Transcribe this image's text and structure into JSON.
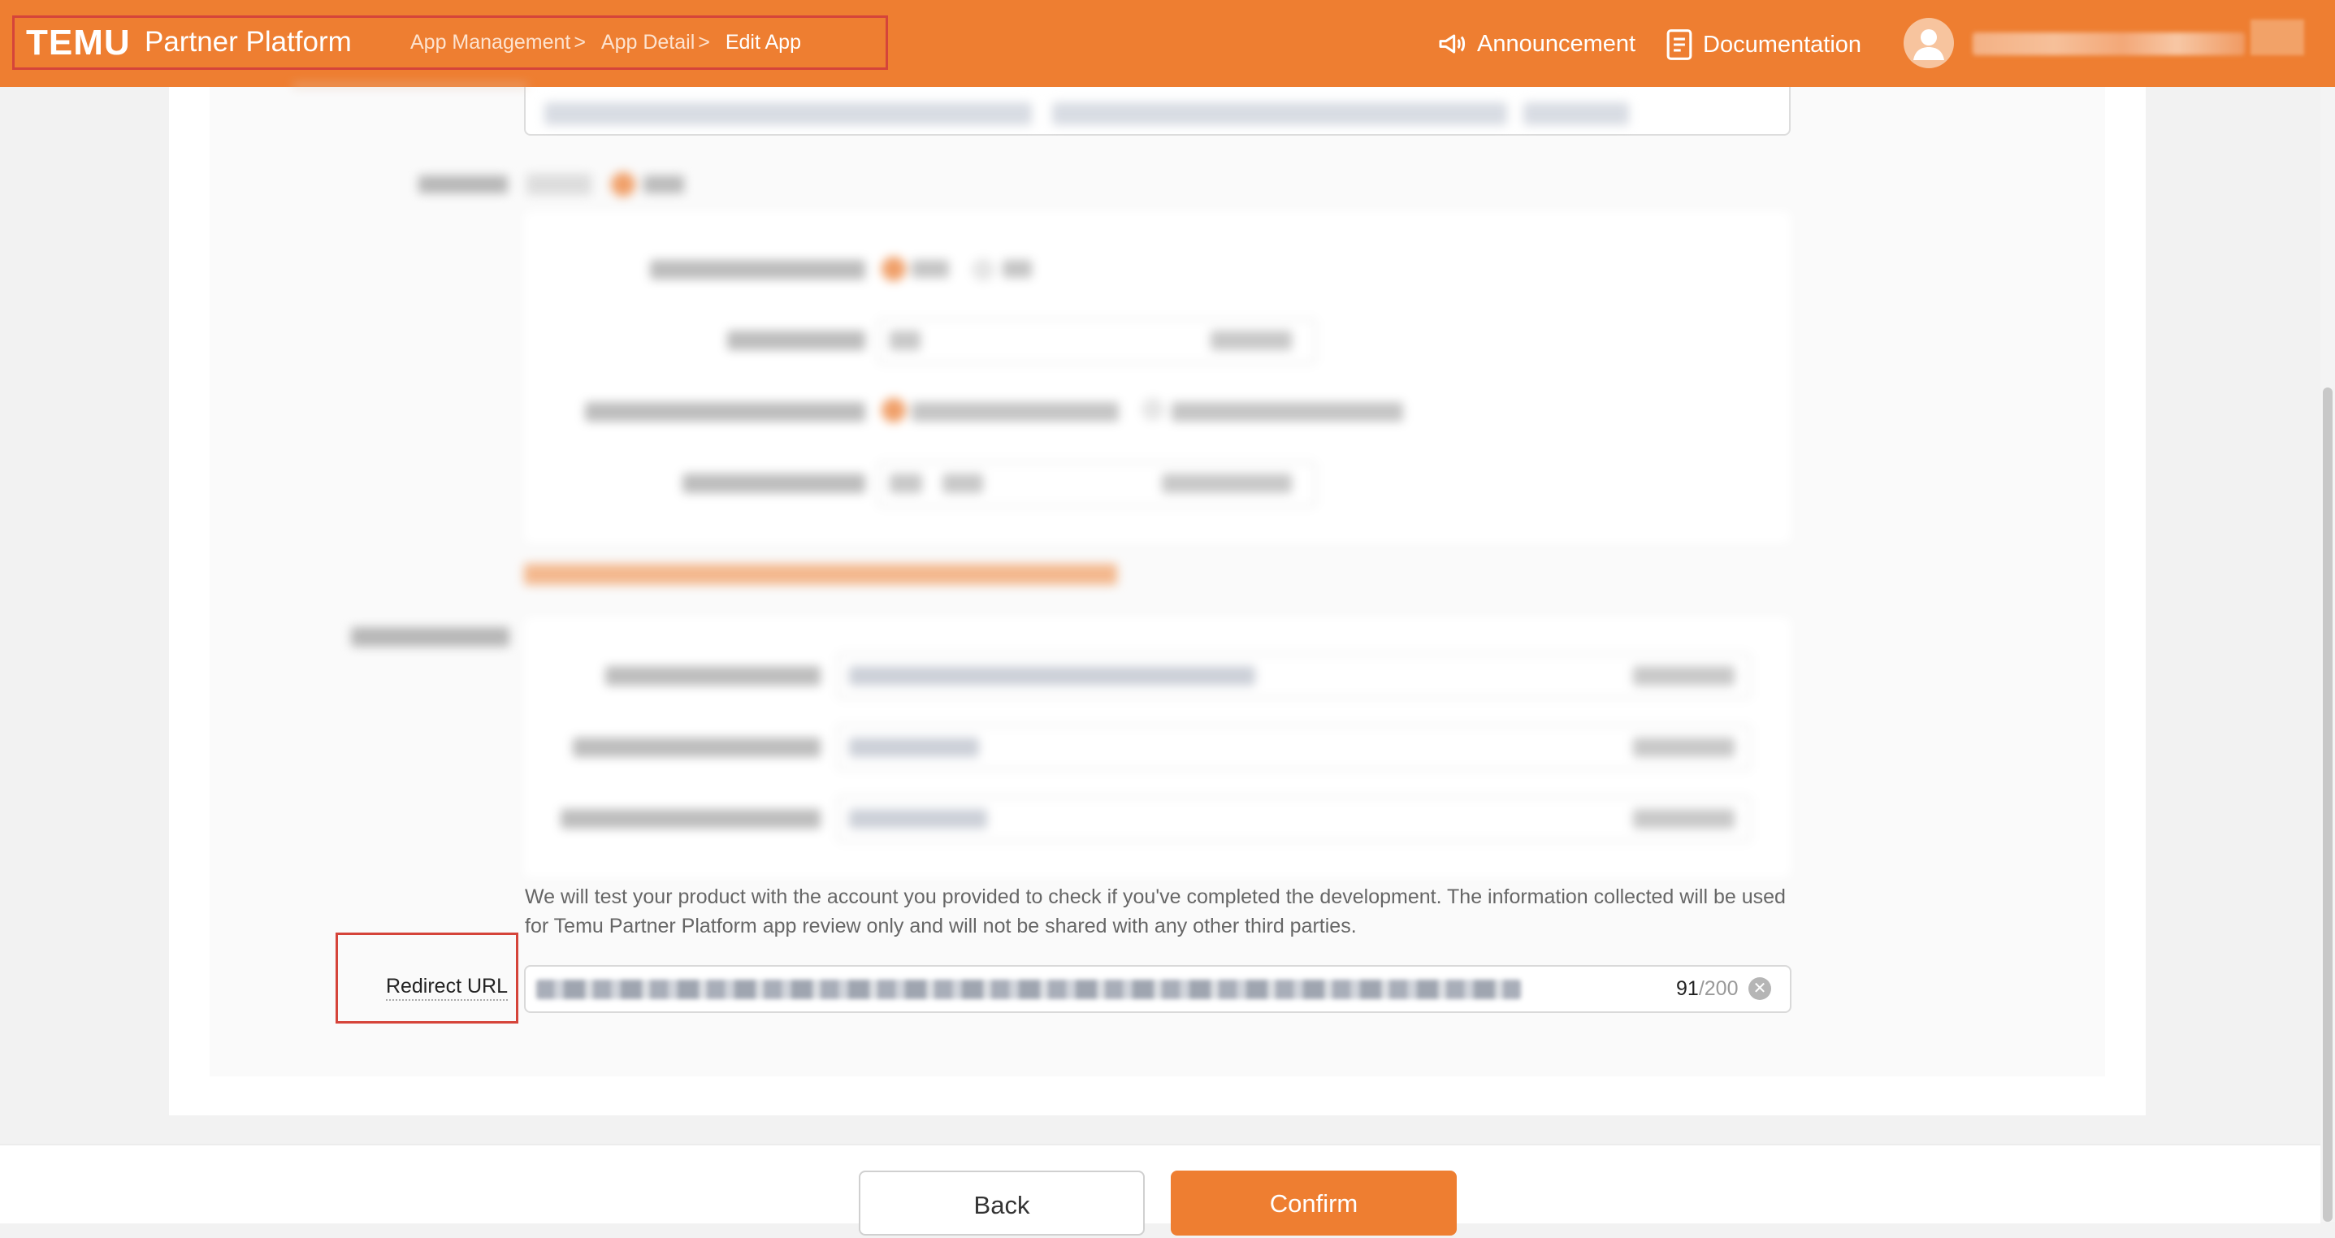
{
  "header": {
    "logo": "TEMU",
    "platform": "Partner Platform",
    "breadcrumb": [
      {
        "label": "App Management",
        "sep": ">"
      },
      {
        "label": "App Detail",
        "sep": ">"
      },
      {
        "label": "Edit App",
        "sep": ""
      }
    ],
    "announcement": "Announcement",
    "documentation": "Documentation"
  },
  "form": {
    "info_text": "We will test your product with the account you provided to check if you've completed the development. The information collected will be used for Temu Partner Platform app review only and will not be shared with any other third parties.",
    "redirect": {
      "label": "Redirect URL",
      "count_current": "91",
      "count_max": "/200"
    }
  },
  "footer": {
    "back": "Back",
    "confirm": "Confirm"
  },
  "colors": {
    "brand": "#ee7e31",
    "highlight": "#d5443a"
  },
  "icons": [
    "megaphone-icon",
    "document-icon",
    "user-icon",
    "clear-icon"
  ]
}
